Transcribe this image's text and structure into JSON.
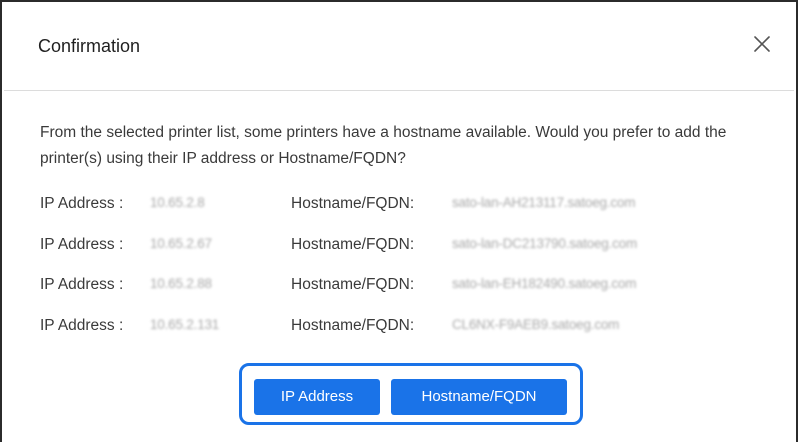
{
  "dialog": {
    "title": "Confirmation",
    "close_icon": "close-icon",
    "message": "From the selected printer list, some printers have a hostname available. Would you prefer to add the printer(s) using their IP address or Hostname/FQDN?"
  },
  "printers": [
    {
      "ip_label": "IP Address :",
      "ip": "10.65.2.8",
      "host_label": "Hostname/FQDN:",
      "hostname": "sato-lan-AH213117.satoeg.com"
    },
    {
      "ip_label": "IP Address :",
      "ip": "10.65.2.67",
      "host_label": "Hostname/FQDN:",
      "hostname": "sato-lan-DC213790.satoeg.com"
    },
    {
      "ip_label": "IP Address :",
      "ip": "10.65.2.88",
      "host_label": "Hostname/FQDN:",
      "hostname": "sato-lan-EH182490.satoeg.com"
    },
    {
      "ip_label": "IP Address :",
      "ip": "10.65.2.131",
      "host_label": "Hostname/FQDN:",
      "hostname": "CL6NX-F9AEB9.satoeg.com"
    }
  ],
  "buttons": {
    "ip_address": "IP Address",
    "hostname": "Hostname/FQDN"
  },
  "colors": {
    "accent": "#1a73e8",
    "text": "#3a3a3a",
    "redacted_text": "#a9a9a9"
  }
}
